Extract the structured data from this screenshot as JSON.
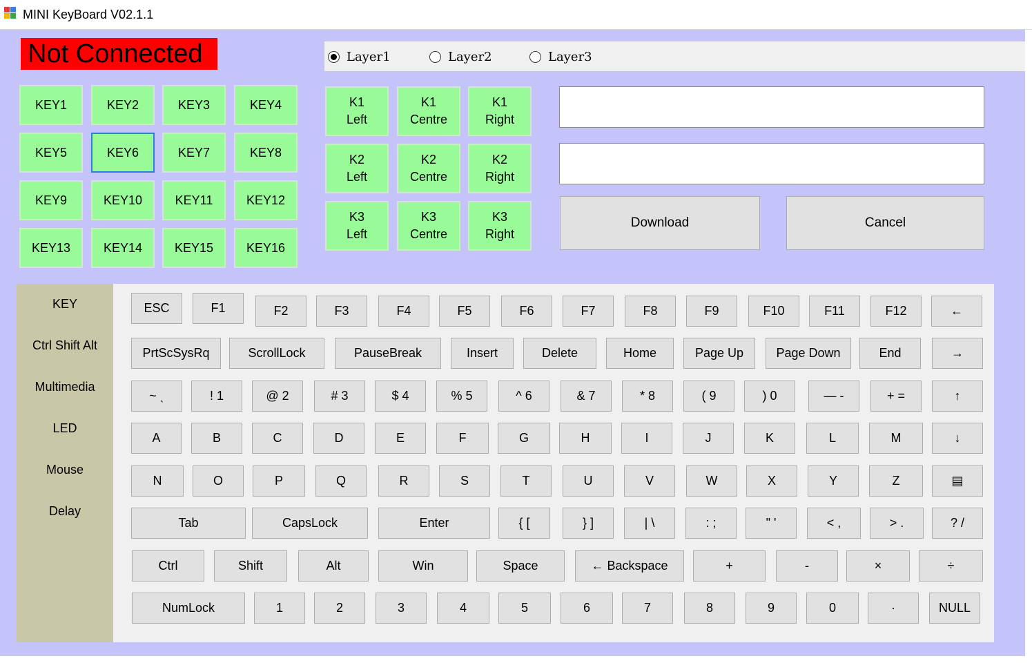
{
  "window": {
    "title": "MINI KeyBoard V02.1.1"
  },
  "status": {
    "text": "Not Connected"
  },
  "layers": [
    {
      "label": "Layer1",
      "checked": true
    },
    {
      "label": "Layer2",
      "checked": false
    },
    {
      "label": "Layer3",
      "checked": false
    }
  ],
  "keys": [
    "KEY1",
    "KEY2",
    "KEY3",
    "KEY4",
    "KEY5",
    "KEY6",
    "KEY7",
    "KEY8",
    "KEY9",
    "KEY10",
    "KEY11",
    "KEY12",
    "KEY13",
    "KEY14",
    "KEY15",
    "KEY16"
  ],
  "knobs": [
    {
      "top": "K1",
      "bottom": "Left"
    },
    {
      "top": "K1",
      "bottom": "Centre"
    },
    {
      "top": "K1",
      "bottom": "Right"
    },
    {
      "top": "K2",
      "bottom": "Left"
    },
    {
      "top": "K2",
      "bottom": "Centre"
    },
    {
      "top": "K2",
      "bottom": "Right"
    },
    {
      "top": "K3",
      "bottom": "Left"
    },
    {
      "top": "K3",
      "bottom": "Centre"
    },
    {
      "top": "K3",
      "bottom": "Right"
    }
  ],
  "textboxes": [
    "",
    ""
  ],
  "actions": {
    "download": "Download",
    "cancel": "Cancel"
  },
  "categories": [
    "KEY",
    "Ctrl Shift Alt",
    "Multimedia",
    "LED",
    "Mouse",
    "Delay"
  ],
  "keyboard": {
    "row1": [
      "ESC",
      "F1",
      "F2",
      "F3",
      "F4",
      "F5",
      "F6",
      "F7",
      "F8",
      "F9",
      "F10",
      "F11",
      "F12",
      "←"
    ],
    "row2": [
      "PrtScSysRq",
      "ScrollLock",
      "PauseBreak",
      "Insert",
      "Delete",
      "Home",
      "Page Up",
      "Page Down",
      "End",
      "→"
    ],
    "row3": [
      "~ ˎ",
      "! 1",
      "@ 2",
      "# 3",
      "$ 4",
      "% 5",
      "^ 6",
      "& 7",
      "* 8",
      "( 9",
      ") 0",
      "— -",
      "+ =",
      "↑"
    ],
    "row4": [
      "A",
      "B",
      "C",
      "D",
      "E",
      "F",
      "G",
      "H",
      "I",
      "J",
      "K",
      "L",
      "M",
      "↓"
    ],
    "row5": [
      "N",
      "O",
      "P",
      "Q",
      "R",
      "S",
      "T",
      "U",
      "V",
      "W",
      "X",
      "Y",
      "Z",
      "▤"
    ],
    "row6": [
      "Tab",
      "CapsLock",
      "Enter",
      "{ [",
      "} ]",
      "| \\",
      ":  ;",
      "\"  '",
      "<  ,",
      ">  .",
      "?  /"
    ],
    "row7": [
      "Ctrl",
      "Shift",
      "Alt",
      "Win",
      "Space",
      "← Backspace",
      "+",
      "-",
      "×",
      "÷"
    ],
    "row8": [
      "NumLock",
      "1",
      "2",
      "3",
      "4",
      "5",
      "6",
      "7",
      "8",
      "9",
      "0",
      "·",
      "NULL"
    ]
  },
  "colors": {
    "background": "#c4c4fb",
    "key_green": "#98fb98",
    "status_red": "#ff0000",
    "category_panel": "#c8c8a9",
    "focus_blue": "#2f7de1"
  }
}
